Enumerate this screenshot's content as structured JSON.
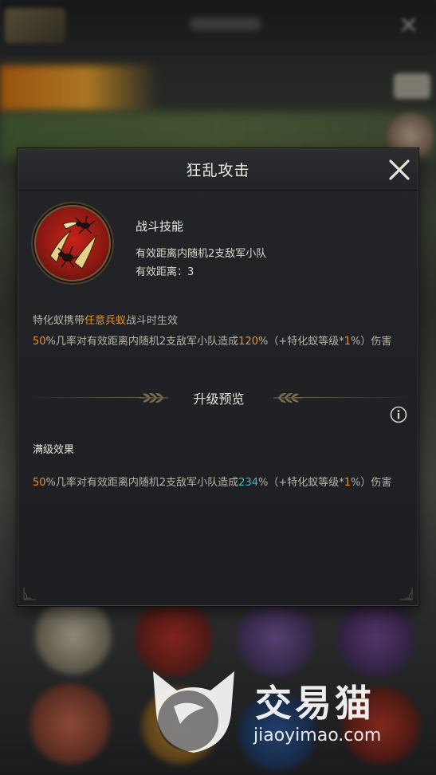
{
  "dialog": {
    "title": "狂乱攻击"
  },
  "skill": {
    "type": "战斗技能",
    "description": "有效距离内随机2支敌军小队",
    "range_label": "有效距离：",
    "range_value": "3"
  },
  "condition": {
    "prefix": "特化蚁携带",
    "highlight": "任意兵蚁",
    "suffix": "战斗时生效"
  },
  "current_effect": {
    "chance": "50",
    "text1": "%几率对有效距离内随机2支敌军小队造成",
    "damage": "120",
    "text2": "%（+特化蚁等级*",
    "scale": "1",
    "text3": "%）伤害"
  },
  "upgrade_preview": {
    "title": "升级预览"
  },
  "max_effect": {
    "title": "满级效果",
    "chance": "50",
    "text1": "%几率对有效距离内随机2支敌军小队造成",
    "damage": "234",
    "text2": "%（+特化蚁等级*",
    "scale": "1",
    "text3": "%）伤害"
  },
  "watermark": {
    "name": "交易猫",
    "url": "jiaoyimao.com"
  },
  "colors": {
    "highlight_orange": "#e8932c",
    "highlight_teal": "#45b6c4",
    "dialog_bg": "#1d1e22",
    "skill_icon_red": "#c6221a"
  },
  "icons": {
    "close": "close-x-icon",
    "info": "info-icon",
    "skill": "ant-claw-skill-icon",
    "divider": "laurel-leaf-icon"
  }
}
